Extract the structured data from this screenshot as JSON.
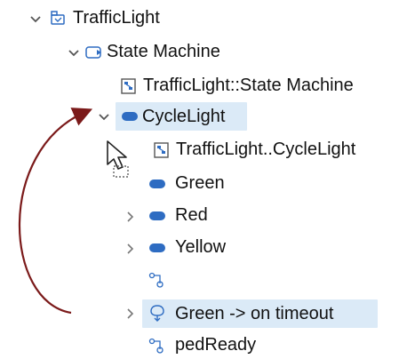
{
  "tree": {
    "root": {
      "label": "TrafficLight",
      "icon": "package-icon",
      "expanded": true
    },
    "state_machine": {
      "label": "State Machine",
      "icon": "state-machine-icon",
      "expanded": true
    },
    "diagram_sm": {
      "label": "TrafficLight::State Machine",
      "icon": "diagram-icon"
    },
    "cyclelight": {
      "label": "CycleLight",
      "icon": "state-icon",
      "expanded": true,
      "selected": true
    },
    "diagram_cl": {
      "label": "TrafficLight..CycleLight",
      "icon": "diagram-icon"
    },
    "green": {
      "label": "Green",
      "icon": "state-icon"
    },
    "red": {
      "label": "Red",
      "icon": "state-icon",
      "expanded": false
    },
    "yellow": {
      "label": "Yellow",
      "icon": "state-icon",
      "expanded": false
    },
    "unnamed": {
      "label": "",
      "icon": "pseudostate-icon"
    },
    "transition": {
      "label": "Green ->  on timeout",
      "icon": "transition-icon",
      "expanded": false,
      "selected": true
    },
    "pedready": {
      "label": "pedReady",
      "icon": "pseudostate-icon"
    }
  },
  "colors": {
    "selection": "#dbeaf7",
    "arrow": "#7b1a1a",
    "icon_blue": "#2e6cc2",
    "chevron": "#555555"
  },
  "overlay": {
    "cursor": "drag-cursor-icon",
    "arrow": "curved-arrow"
  }
}
